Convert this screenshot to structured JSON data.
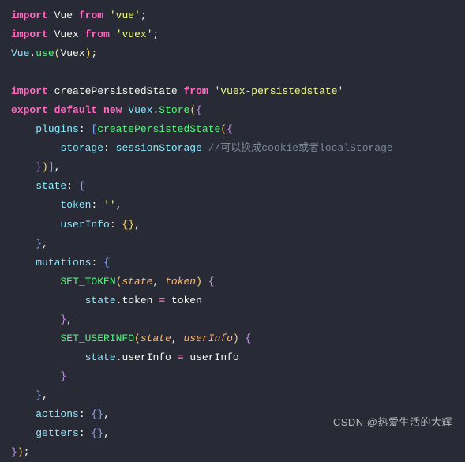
{
  "code": {
    "l1": {
      "kw_import": "import",
      "vue": "Vue",
      "kw_from": "from",
      "str_vue": "'vue'",
      "semi": ";"
    },
    "l2": {
      "kw_import": "import",
      "vuex": "Vuex",
      "kw_from": "from",
      "str_vuex": "'vuex'",
      "semi": ";"
    },
    "l3": {
      "vue": "Vue",
      "dot": ".",
      "use": "use",
      "lp": "(",
      "vuex": "Vuex",
      "rp": ")",
      "semi": ";"
    },
    "l4": "",
    "l5": {
      "kw_import": "import",
      "cps": "createPersistedState",
      "kw_from": "from",
      "str_vpx": "'vuex-persistedstate'"
    },
    "l6": {
      "kw_export": "export",
      "kw_default": "default",
      "kw_new": "new",
      "vuex": "Vuex",
      "dot": ".",
      "store": "Store",
      "lp": "(",
      "lb": "{"
    },
    "l7": {
      "plugins": "plugins",
      "colon": ":",
      "lbrk": "[",
      "cps": "createPersistedState",
      "lp": "(",
      "lb": "{"
    },
    "l8": {
      "storage": "storage",
      "colon": ":",
      "ss": "sessionStorage",
      "comment": "//可以换成cookie或者localStorage"
    },
    "l9": {
      "rb": "}",
      "rp": ")",
      "rbrk": "]",
      "comma": ","
    },
    "l10": {
      "state": "state",
      "colon": ":",
      "lb": "{"
    },
    "l11": {
      "token": "token",
      "colon": ":",
      "empty": "''",
      "comma": ","
    },
    "l12": {
      "userInfo": "userInfo",
      "colon": ":",
      "lb": "{",
      "rb": "}",
      "comma": ","
    },
    "l13": {
      "rb": "}",
      "comma": ","
    },
    "l14": {
      "mutations": "mutations",
      "colon": ":",
      "lb": "{"
    },
    "l15": {
      "fn": "SET_TOKEN",
      "lp": "(",
      "p1": "state",
      "comma": ",",
      "p2": "token",
      "rp": ")",
      "lb": "{"
    },
    "l16": {
      "state": "state",
      "dot": ".",
      "token": "token",
      "eq": "=",
      "rhs": "token"
    },
    "l17": {
      "rb": "}",
      "comma": ","
    },
    "l18": {
      "fn": "SET_USERINFO",
      "lp": "(",
      "p1": "state",
      "comma": ",",
      "p2": "userInfo",
      "rp": ")",
      "lb": "{"
    },
    "l19": {
      "state": "state",
      "dot": ".",
      "userInfo": "userInfo",
      "eq": "=",
      "rhs": "userInfo"
    },
    "l20": {
      "rb": "}"
    },
    "l21": {
      "rb": "}",
      "comma": ","
    },
    "l22": {
      "actions": "actions",
      "colon": ":",
      "lb": "{",
      "rb": "}",
      "comma": ","
    },
    "l23": {
      "getters": "getters",
      "colon": ":",
      "lb": "{",
      "rb": "}",
      "comma": ","
    },
    "l24": {
      "rb": "}",
      "rp": ")",
      "semi": ";"
    }
  },
  "watermark": "CSDN @热爱生活的大辉"
}
